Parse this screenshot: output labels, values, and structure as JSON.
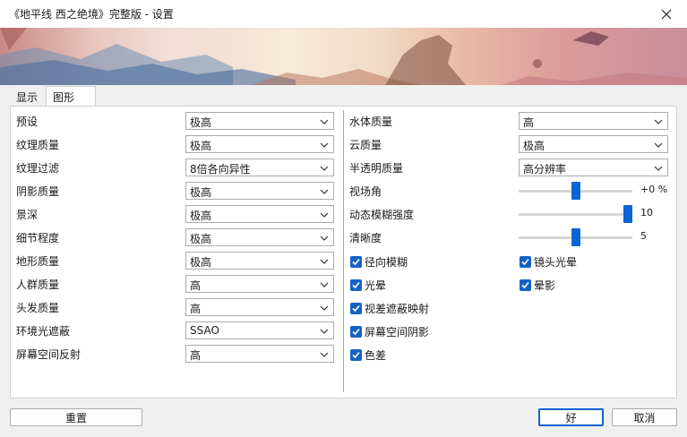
{
  "window": {
    "title": "《地平线 西之绝境》完整版 - 设置"
  },
  "tabs": [
    "显示",
    "图形"
  ],
  "left_settings": [
    {
      "label": "预设",
      "value": "极高"
    },
    {
      "label": "纹理质量",
      "value": "极高"
    },
    {
      "label": "纹理过滤",
      "value": "8倍各向异性"
    },
    {
      "label": "阴影质量",
      "value": "极高"
    },
    {
      "label": "景深",
      "value": "极高"
    },
    {
      "label": "细节程度",
      "value": "极高"
    },
    {
      "label": "地形质量",
      "value": "极高"
    },
    {
      "label": "人群质量",
      "value": "高"
    },
    {
      "label": "头发质量",
      "value": "高"
    },
    {
      "label": "环境光遮蔽",
      "value": "SSAO"
    },
    {
      "label": "屏幕空间反射",
      "value": "高"
    }
  ],
  "right_settings": [
    {
      "label": "水体质量",
      "value": "高"
    },
    {
      "label": "云质量",
      "value": "极高"
    },
    {
      "label": "半透明质量",
      "value": "高分辨率"
    }
  ],
  "sliders": [
    {
      "label": "视场角",
      "value": "+0 %",
      "level": 0.5
    },
    {
      "label": "动态模糊强度",
      "value": "10",
      "level": 1.0
    },
    {
      "label": "清晰度",
      "value": "5",
      "level": 0.5
    }
  ],
  "checks_left": [
    {
      "label": "径向模糊",
      "checked": true
    },
    {
      "label": "光晕",
      "checked": true
    },
    {
      "label": "视差遮蔽映射",
      "checked": true
    },
    {
      "label": "屏幕空间阴影",
      "checked": true
    },
    {
      "label": "色差",
      "checked": true
    }
  ],
  "checks_right": [
    {
      "label": "镜头光晕",
      "checked": true
    },
    {
      "label": "晕影",
      "checked": true
    }
  ],
  "buttons": {
    "reset": "重置",
    "ok": "好",
    "cancel": "取消"
  },
  "colors": {
    "accent": "#0a64d2",
    "checkbox": "#1562c6"
  }
}
